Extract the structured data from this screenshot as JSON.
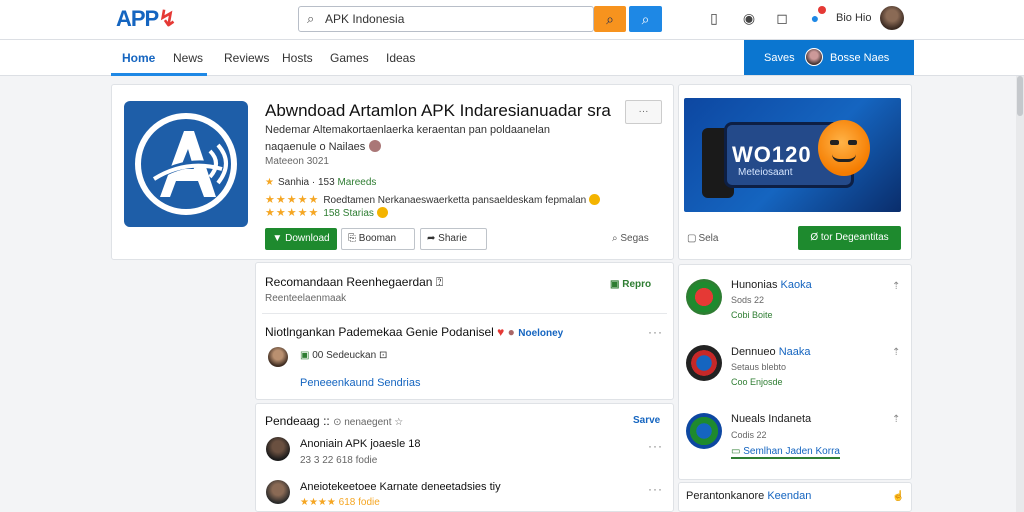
{
  "header": {
    "logo": "APP",
    "search_value": "APK Indonesia",
    "user_name": "Bio Hio"
  },
  "nav": {
    "tabs": [
      "Home",
      "News",
      "Reviews",
      "Hosts",
      "Games",
      "Ideas"
    ],
    "cta_label": "Saves",
    "cta_user": "Bosse Naes"
  },
  "app": {
    "title": "Abwndoad Artamlon APK Indaresianuadar sra",
    "description_1": "Nedemar Altemakortaenlaerka keraentan pan poldaanelan",
    "description_2": "naqaenule o Nailaes",
    "meta": "Mateeon 3021",
    "rating_label": "Sanhia",
    "rating_count": "153",
    "downloads": "Mareeds",
    "review_text": "Roedtamen Nerkanaeswaerketta pansaeldeskam fepmalan",
    "review_stars": "★★★★★",
    "review_stars_2": "★★★★★",
    "review_count": "158 Starias",
    "download_label": "▼ Download",
    "bookmark_label": "Booman",
    "share_label": "Sharie",
    "more_label": "···",
    "report_label": "Segas"
  },
  "sections": {
    "recommended": {
      "title": "Recomandaan Reenhegaerdan",
      "subtitle": "Reenteelaenmaak",
      "right_label": "Repro"
    },
    "news": {
      "title": "Niotlngankan Pademekaa Genie Podanisel",
      "tag": "Noeloney",
      "user_meta": "00 Sedeuckan",
      "link": "Peneeenkaund Sendrias"
    },
    "comments": {
      "title": "Pendeaag",
      "subtitle": "nenaegent",
      "right_label": "Sarve",
      "items": [
        {
          "title": "Anoniain APK joaesle 18",
          "meta": "23 3 22   618 fodie"
        },
        {
          "title": "Aneiotekeetoee Karnate deneetadsies tiy",
          "meta": "★★★★ 618 fodie"
        }
      ]
    }
  },
  "sidebar": {
    "promo": {
      "headline": "WO120",
      "subline": "Meteiosaant",
      "label": "Sela",
      "button": "Ø tor Degeantitas"
    },
    "items": [
      {
        "title": "Hunonias",
        "accent": "Kaoka",
        "meta": "Sods 22",
        "meta2": "Cobi Boite"
      },
      {
        "title": "Dennueo",
        "accent": "Naaka",
        "meta": "Setaus blebto",
        "meta2": "Coo Enjosde"
      },
      {
        "title": "Nueals Indaneta",
        "accent": "",
        "meta": "Codis 22",
        "link": "Semlhan Jaden Korra"
      }
    ],
    "footer_title": "Perantonkanore",
    "footer_accent": "Keendan"
  }
}
